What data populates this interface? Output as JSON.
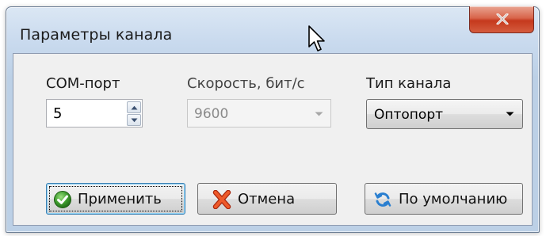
{
  "window": {
    "title": "Параметры канала"
  },
  "com_port": {
    "label": "COM-порт",
    "value": "5"
  },
  "speed": {
    "label": "Скорость,  бит/с",
    "value": "9600",
    "enabled": false
  },
  "channel_type": {
    "label": "Тип канала",
    "value": "Оптопорт"
  },
  "buttons": {
    "apply": "Применить",
    "cancel": "Отмена",
    "defaults": "По умолчанию"
  },
  "icons": {
    "close": "close-icon",
    "apply": "check-icon",
    "cancel": "x-icon",
    "defaults": "refresh-icon",
    "cursor": "mouse-pointer-icon"
  },
  "colors": {
    "close_button": "#c5391d",
    "apply_icon": "#3e9c2e",
    "cancel_icon": "#e2461d",
    "defaults_icon": "#2a7fd0"
  }
}
